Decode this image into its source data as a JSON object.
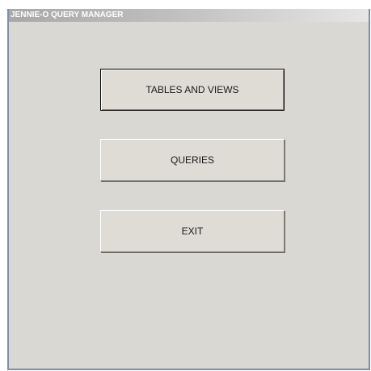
{
  "window": {
    "title": "JENNIE-O QUERY MANAGER"
  },
  "buttons": {
    "tables_views": "TABLES AND VIEWS",
    "queries": "QUERIES",
    "exit": "EXIT"
  },
  "colors": {
    "background": "#d9d8d2",
    "titlebar_start": "#a8a8a8",
    "titlebar_end": "#e6e6e6",
    "border": "#7f8fa8"
  }
}
